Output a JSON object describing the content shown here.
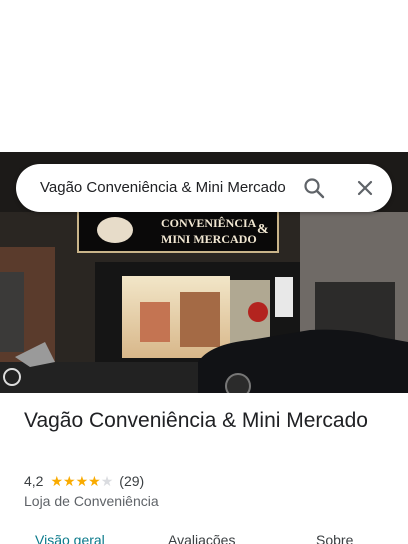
{
  "search": {
    "query": "Vagão Conveniência & Mini Mercado"
  },
  "photo": {
    "sign_line1": "CONVENIÊNCIA",
    "sign_line2": "MINI MERCADO",
    "sign_amp": "&"
  },
  "place": {
    "title": "Vagão Conveniência & Mini Mercado",
    "rating": "4,2",
    "rating_value": 4.2,
    "review_count": "(29)",
    "category": "Loja de Conveniência"
  },
  "tabs": [
    {
      "label": "Visão geral"
    },
    {
      "label": "Avaliações"
    },
    {
      "label": "Sobre"
    }
  ],
  "colors": {
    "star": "#f9ab00",
    "active_tab": "#0b7a8b"
  }
}
